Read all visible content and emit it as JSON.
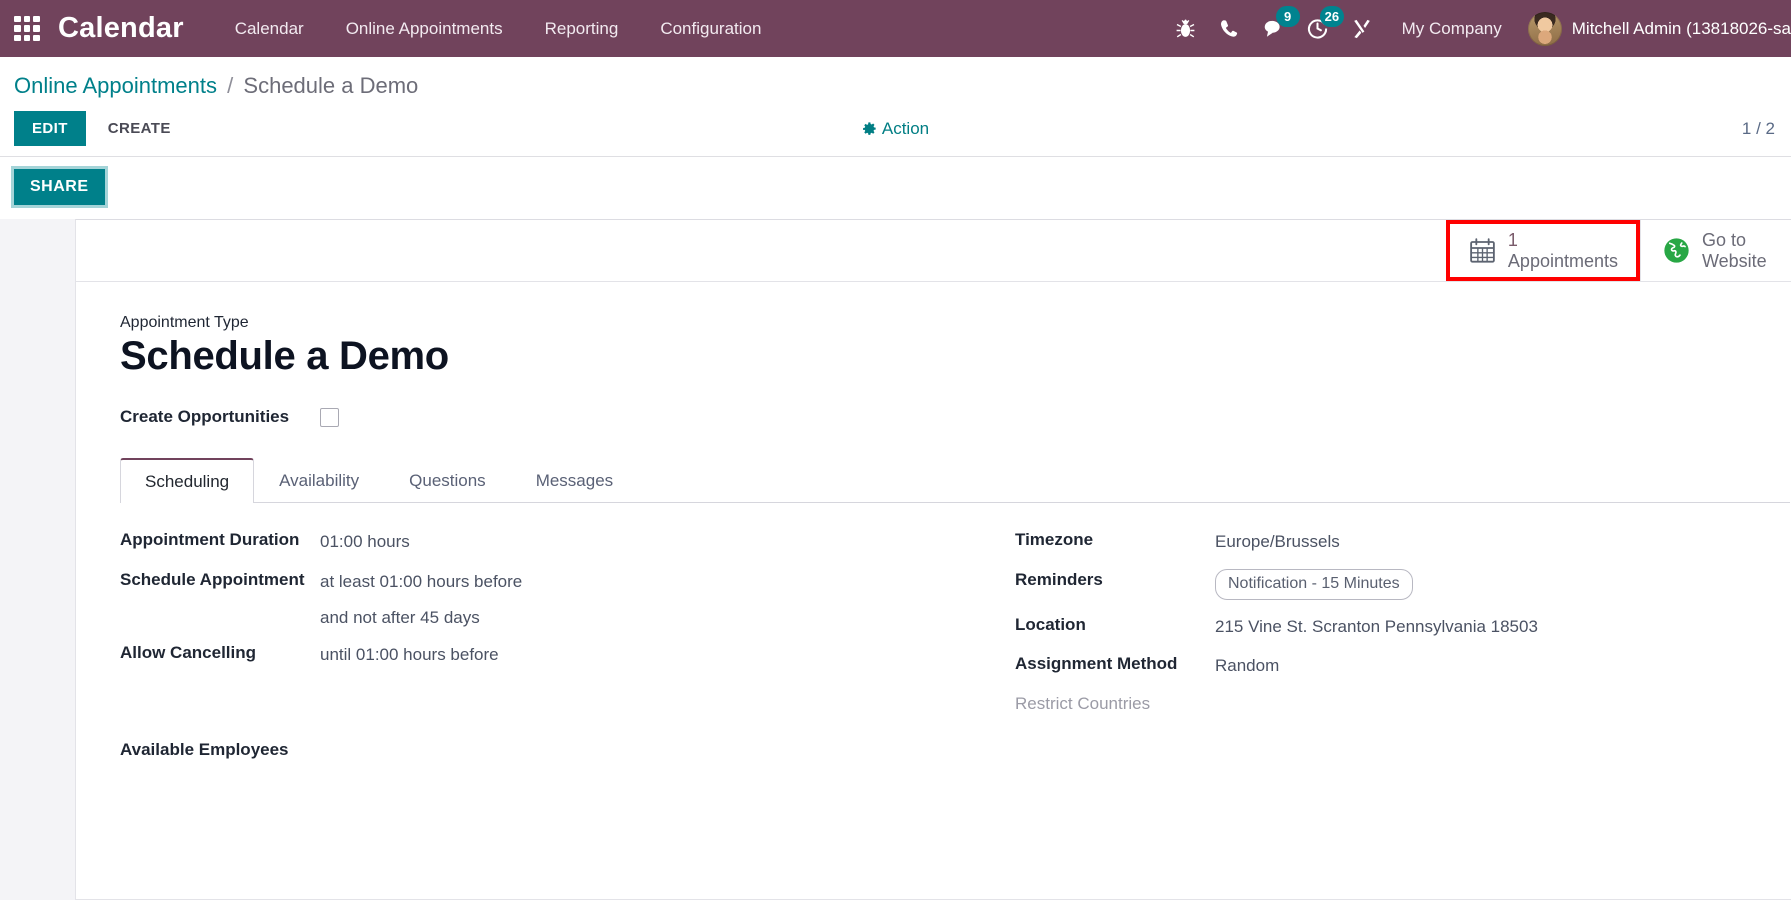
{
  "navbar": {
    "apps_icon": "apps-grid-icon",
    "brand": "Calendar",
    "menu": [
      {
        "label": "Calendar"
      },
      {
        "label": "Online Appointments"
      },
      {
        "label": "Reporting"
      },
      {
        "label": "Configuration"
      }
    ],
    "icons": [
      {
        "name": "bug-icon",
        "badge": null
      },
      {
        "name": "phone-icon",
        "badge": null
      },
      {
        "name": "messages-icon",
        "badge": "9"
      },
      {
        "name": "activities-clock-icon",
        "badge": "26"
      },
      {
        "name": "developer-tools-icon",
        "badge": null
      }
    ],
    "company": "My Company",
    "user": "Mitchell Admin (13818026-sa",
    "accent_purple": "#71435c",
    "badge_color": "#00838f"
  },
  "control_panel": {
    "breadcrumb": {
      "parent": "Online Appointments",
      "separator": "/",
      "current": "Schedule a Demo"
    },
    "edit_label": "EDIT",
    "create_label": "CREATE",
    "action_label": "Action",
    "action_icon": "gear-icon",
    "pager": "1 / 2",
    "share_label": "SHARE",
    "teal": "#00808a"
  },
  "stat_buttons": [
    {
      "icon": "calendar-icon",
      "value": "1",
      "label": "Appointments",
      "highlighted": true,
      "highlight_color": "#ff0000"
    },
    {
      "icon": "globe-icon",
      "line1": "Go to",
      "line2": "Website",
      "highlighted": false,
      "icon_color": "#28a745"
    }
  ],
  "form": {
    "type_label": "Appointment Type",
    "title": "Schedule a Demo",
    "create_opportunities": {
      "label": "Create Opportunities",
      "checked": false
    },
    "tabs": [
      {
        "label": "Scheduling",
        "active": true
      },
      {
        "label": "Availability",
        "active": false
      },
      {
        "label": "Questions",
        "active": false
      },
      {
        "label": "Messages",
        "active": false
      }
    ],
    "left_fields": [
      {
        "label": "Appointment Duration",
        "value": "01:00 hours"
      },
      {
        "label": "Schedule Appointment",
        "value": "at least 01:00 hours before",
        "value2": "and not after 45 days"
      },
      {
        "label": "Allow Cancelling",
        "value": "until 01:00 hours before"
      }
    ],
    "right_fields": [
      {
        "label": "Timezone",
        "value": "Europe/Brussels",
        "kind": "text"
      },
      {
        "label": "Reminders",
        "value": "Notification - 15 Minutes",
        "kind": "tag"
      },
      {
        "label": "Location",
        "value": "215 Vine St. Scranton Pennsylvania 18503",
        "kind": "text"
      },
      {
        "label": "Assignment Method",
        "value": "Random",
        "kind": "text"
      },
      {
        "label": "Restrict Countries",
        "value": "",
        "kind": "muted"
      }
    ],
    "available_employees_label": "Available Employees"
  }
}
